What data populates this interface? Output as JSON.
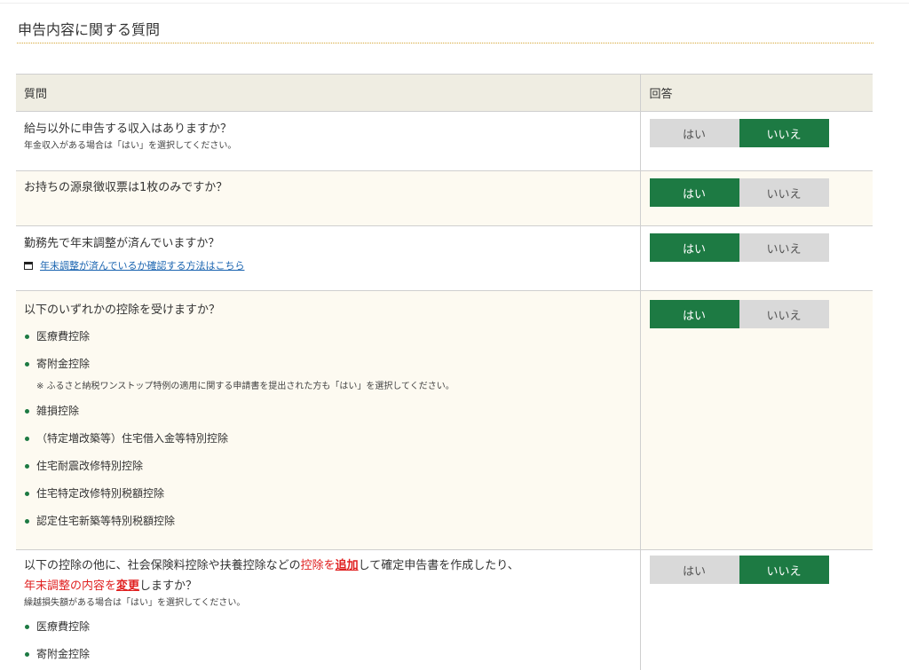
{
  "page": {
    "title": "申告内容に関する質問"
  },
  "table": {
    "header_question": "質問",
    "header_answer": "回答"
  },
  "answers": {
    "yes": "はい",
    "no": "いいえ"
  },
  "colors": {
    "selected": "#1d7a43",
    "unselected": "#d9d9d9",
    "header_bg": "#efede2",
    "alt_row_bg": "#fdfaf1",
    "accent_rule": "#d4a634",
    "emphasis": "#e02020"
  },
  "q1": {
    "text": "給与以外に申告する収入はありますか？",
    "note": "年金収入がある場合は「はい」を選択してください。",
    "selected": "いいえ"
  },
  "q2": {
    "text": "お持ちの源泉徴収票は1枚のみですか？",
    "selected": "はい"
  },
  "q3": {
    "text": "勤務先で年末調整が済んでいますか？",
    "link": "年末調整が済んでいるか確認する方法はこちら",
    "link_icon": "window-icon",
    "selected": "はい"
  },
  "q4": {
    "text": "以下のいずれかの控除を受けますか？",
    "items": [
      "医療費控除",
      "寄附金控除",
      "雑損控除",
      "（特定増改築等）住宅借入金等特別控除",
      "住宅耐震改修特別控除",
      "住宅特定改修特別税額控除",
      "認定住宅新築等特別税額控除"
    ],
    "donation_note": "※ ふるさと納税ワンストップ特例の適用に関する申請書を提出された方も「はい」を選択してください。",
    "selected": "はい"
  },
  "q5": {
    "line1_a": "以下の控除の他に、社会保険料控除や扶養控除などの",
    "line1_red": "控除を",
    "line1_red_bold": "追加",
    "line1_b": "して確定申告書を作成したり、",
    "line2_red": "年末調整の内容を",
    "line2_red_bold": "変更",
    "line2_b": "しますか？",
    "note": "繰越損失額がある場合は「はい」を選択してください。",
    "items": [
      "医療費控除",
      "寄附金控除"
    ],
    "selected": "いいえ"
  }
}
